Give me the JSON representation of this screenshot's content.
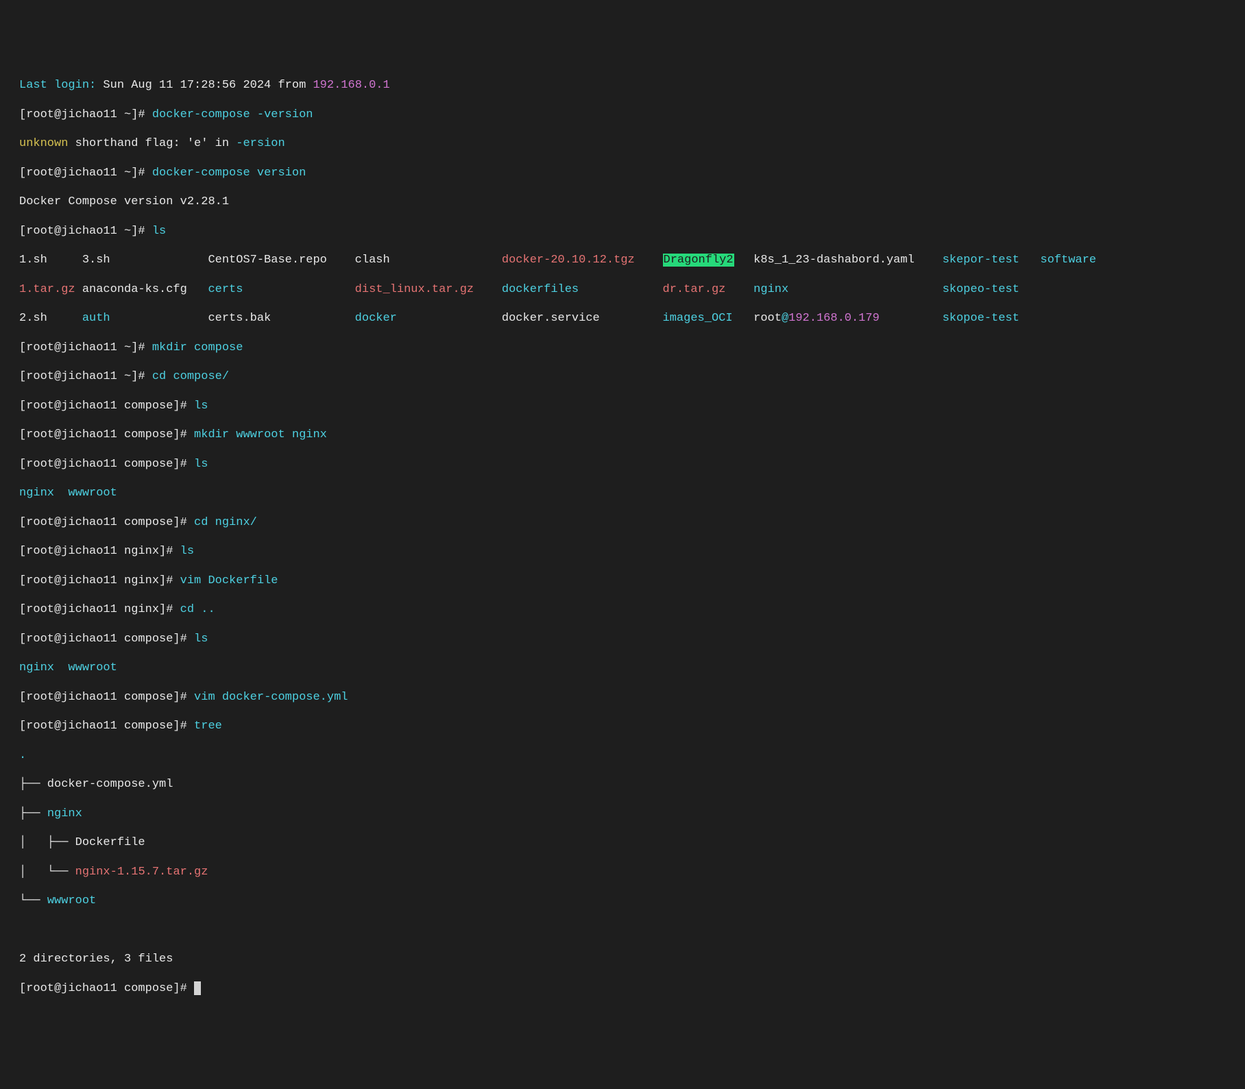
{
  "login": {
    "prefix": "Last login:",
    "datetime": "Sun Aug 11 17:28:56 2024 from",
    "ip": "192.168.0.1"
  },
  "prompts": {
    "home": "[root@jichao11 ~]#",
    "compose": "[root@jichao11 compose]#",
    "nginx": "[root@jichao11 nginx]#"
  },
  "commands": {
    "dc_version_typo": "docker-compose -version",
    "dc_version": "docker-compose version",
    "ls": "ls",
    "mkdir_compose": "mkdir compose",
    "cd_compose": "cd compose/",
    "mkdir_wn": "mkdir wwwroot nginx",
    "cd_nginx": "cd nginx/",
    "vim_docker": "vim Dockerfile",
    "cd_up": "cd ..",
    "vim_dcy": "vim docker-compose.yml",
    "tree": "tree"
  },
  "errors": {
    "unknown_flag_pre": "unknown",
    "unknown_flag_mid": "shorthand flag: 'e' in",
    "unknown_flag_arg": "-ersion"
  },
  "output": {
    "dc_version_line": "Docker Compose version v2.28.1",
    "ls_dirs": "nginx  wwwroot",
    "tree_summary": "2 directories, 3 files"
  },
  "ls_columns": {
    "row1": {
      "c1": "1.sh",
      "c2": "3.sh",
      "c3": "CentOS7-Base.repo",
      "c4": "clash",
      "c5": "docker-20.10.12.tgz",
      "c6": "Dragonfly2",
      "c7": "k8s_1_23-dashabord.yaml",
      "c8": "skepor-test",
      "c9": "software"
    },
    "row2": {
      "c1": "1.tar.gz",
      "c2": "anaconda-ks.cfg",
      "c3": "certs",
      "c4": "dist_linux.tar.gz",
      "c5": "dockerfiles",
      "c6": "dr.tar.gz",
      "c7": "nginx",
      "c8": "skopeo-test"
    },
    "row3": {
      "c1": "2.sh",
      "c2": "auth",
      "c3": "certs.bak",
      "c4": "docker",
      "c5": "docker.service",
      "c6": "images_OCI",
      "c7_a": "root",
      "c7_b": "@",
      "c7_c": "192.168.0.179",
      "c8": "skopoe-test"
    }
  },
  "tree": {
    "dot": ".",
    "l1": "├── docker-compose.yml",
    "l2_pre": "├── ",
    "l2_name": "nginx",
    "l3": "│   ├── Dockerfile",
    "l4_pre": "│   └── ",
    "l4_name": "nginx-1.15.7.tar.gz",
    "l5_pre": "└── ",
    "l5_name": "wwwroot"
  }
}
